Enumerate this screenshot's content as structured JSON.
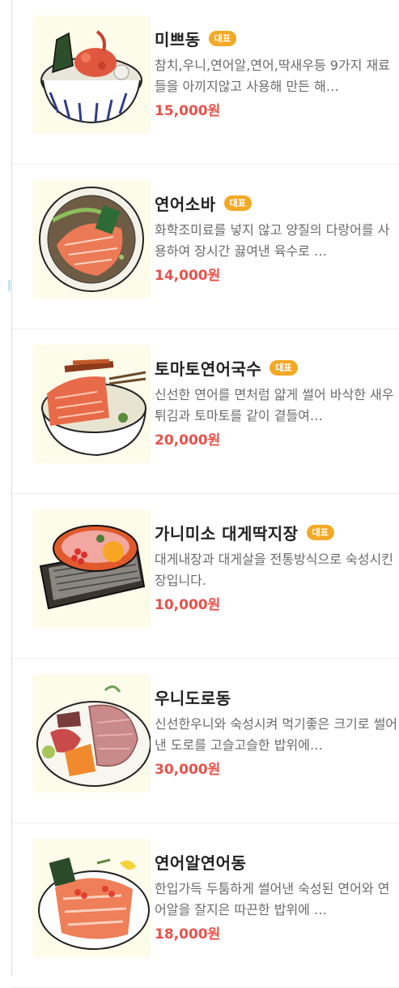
{
  "menu": {
    "items": [
      {
        "name": "미쁘동",
        "badge": "대표",
        "description": "참치,우니,연어알,연어,딱새우등 9가지 재료들을 아끼지않고 사용해 만든 해…",
        "price": "15,000원",
        "image": "maro-don-bowl"
      },
      {
        "name": "연어소바",
        "badge": "대표",
        "description": "화학조미료를 넣지 않고 양질의 다랑어를 사용하여 장시간 끓여낸 육수로 …",
        "price": "14,000원",
        "image": "salmon-soba-bowl"
      },
      {
        "name": "토마토연어국수",
        "badge": "대표",
        "description": "신선한 연어를 면처럼 얇게 썰어 바삭한 새우튀김과 토마토를 같이 곁들여…",
        "price": "20,000원",
        "image": "tomato-salmon-noodle-bowl"
      },
      {
        "name": "가니미소 대게딱지장",
        "badge": "대표",
        "description": "대게내장과 대게살을 전통방식으로 숙성시킨 장입니다.",
        "price": "10,000원",
        "image": "crab-shell-grill"
      },
      {
        "name": "우니도로동",
        "badge": "",
        "description": "신선한우니와 숙성시켜 먹기좋은 크기로 썰어낸 도로를 고슬고슬한 밥위에…",
        "price": "30,000원",
        "image": "uni-toro-plate"
      },
      {
        "name": "연어알연어동",
        "badge": "",
        "description": "한입가득 두툼하게 썰어낸 숙성된 연어와 연어알을 잘지은 따끈한 밥위에 …",
        "price": "18,000원",
        "image": "salmon-roe-salmon-plate"
      }
    ]
  }
}
